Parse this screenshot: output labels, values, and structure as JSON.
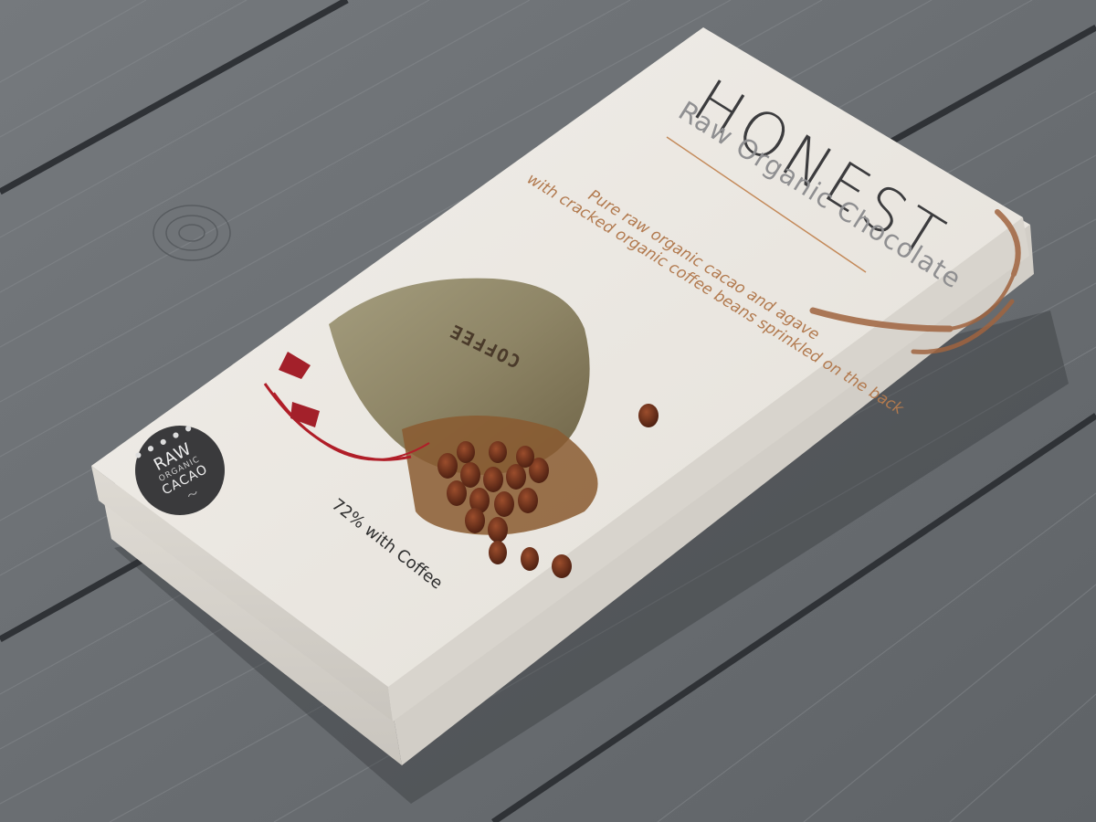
{
  "package": {
    "brand": "HONEST",
    "subtitle": "Raw Organic Chocolate",
    "description_line1": "Pure raw organic cacao and agave",
    "description_line2": "with cracked organic coffee beans sprinkled on the back",
    "flavor": "72% with Coffee",
    "sack_label": "COFFEE"
  },
  "badge": {
    "line1": "RAW",
    "line2": "ORGANIC",
    "line3": "CACAO"
  },
  "colors": {
    "wood": "#6f7377",
    "paper": "#ece8e1",
    "accent": "#b27a4f",
    "badge": "#3a3a3c",
    "ink": "#3c3c3e"
  }
}
